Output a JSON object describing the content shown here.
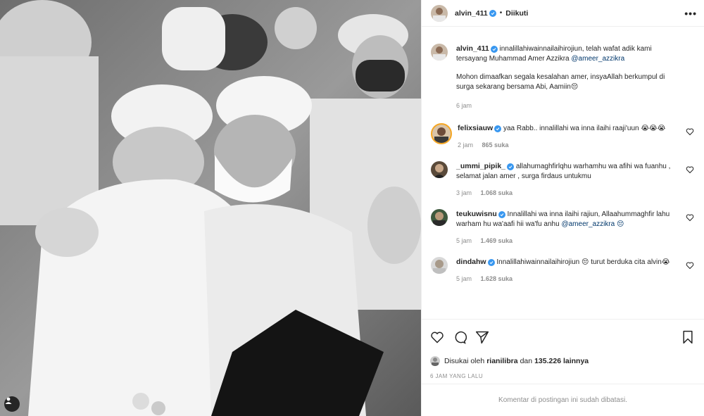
{
  "post": {
    "author": "alvin_411",
    "follow_status": "Diikuti",
    "more_icon": "more-options-icon",
    "caption_author": "alvin_411",
    "caption_text": "innalillahiwainnailaihirojiun, telah wafat adik kami tersayang Muhammad Amer Azzikra",
    "caption_mention": "@ameer_azzikra",
    "caption_text_2": "Mohon dimaafkan segala kesalahan amer, insyaAllah berkumpul di surga sekarang bersama Abi, Aamiin😔",
    "caption_time": "6 jam"
  },
  "comments": [
    {
      "username": "felixsiauw",
      "text": "yaa Rabb.. innalillahi wa inna ilaihi raaji'uun 😭😭😭",
      "mention": "",
      "time": "2 jam",
      "likes": "865 suka"
    },
    {
      "username": "_ummi_pipik_",
      "text": "allahumaghfirlqhu warhamhu wa afihi wa fuanhu , selamat jalan amer , surga firdaus untukmu",
      "mention": "",
      "time": "3 jam",
      "likes": "1.068 suka"
    },
    {
      "username": "teukuwisnu",
      "text": "Innalillahi wa inna ilaihi rajiun, Allaahummaghfir lahu warham hu wa'aafi hii wa'fu anhu",
      "mention": "@ameer_azzikra 😔",
      "time": "5 jam",
      "likes": "1.469 suka"
    },
    {
      "username": "dindahw",
      "text": "Innalillahiwainnailaihirojiun 😔 turut berduka cita alvin😭",
      "mention": "",
      "time": "5 jam",
      "likes": "1.628 suka"
    }
  ],
  "likes": {
    "prefix": "Disukai oleh",
    "user": "rianilibra",
    "middle": "dan",
    "count": "135.226 lainnya"
  },
  "post_time": "6 JAM YANG LALU",
  "comments_closed": "Komentar di postingan ini sudah dibatasi.",
  "colors": {
    "verified": "#3897f0",
    "text": "#262626",
    "muted": "#8e8e8e",
    "border": "#efefef"
  }
}
